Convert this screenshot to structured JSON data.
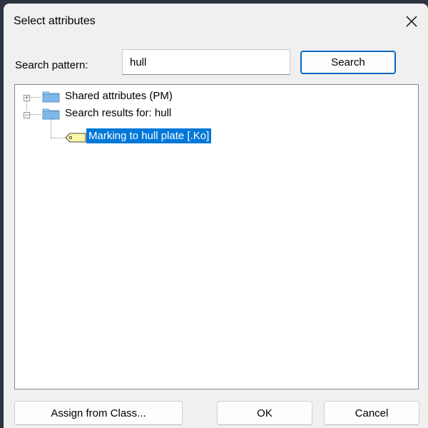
{
  "dialog": {
    "title": "Select attributes"
  },
  "search": {
    "label": "Search pattern:",
    "value": "hull",
    "button_label": "Search"
  },
  "tree": {
    "nodes": [
      {
        "label": "Shared attributes (PM)",
        "expander": "+",
        "icon": "folder-icon"
      },
      {
        "label": "Search results for: hull",
        "expander": "−",
        "icon": "folder-icon"
      },
      {
        "label": "Marking to hull plate [.Ko]",
        "icon": "tag-icon",
        "selected": true
      }
    ]
  },
  "footer": {
    "assign_label": "Assign from Class...",
    "ok_label": "OK",
    "cancel_label": "Cancel"
  },
  "colors": {
    "selection": "#0078d7",
    "folder": "#7fb8e8",
    "tag": "#fff6a8"
  }
}
